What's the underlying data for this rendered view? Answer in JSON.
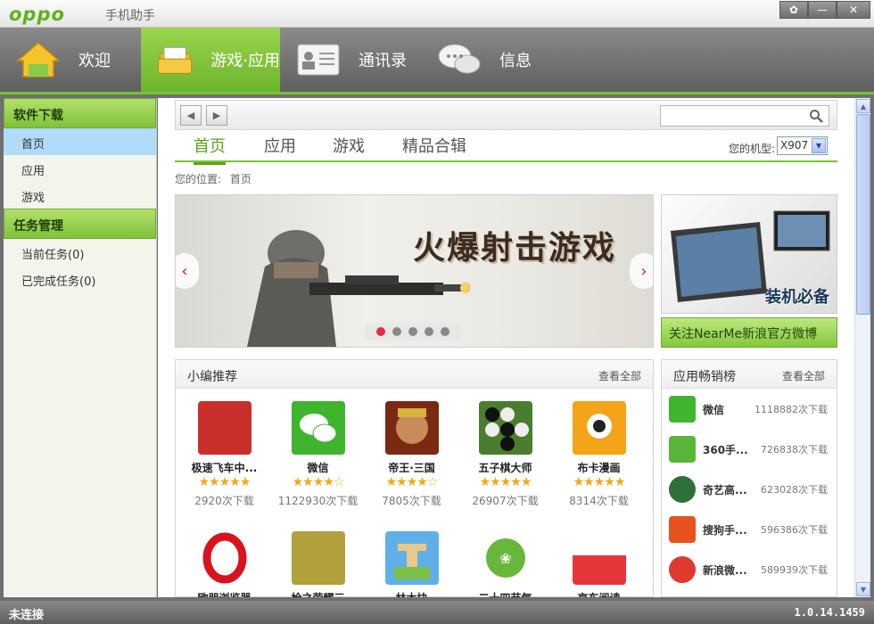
{
  "window": {
    "logo": "oppo",
    "title": "手机助手",
    "buttons": [
      "settings-icon",
      "minimize-icon",
      "close-icon"
    ]
  },
  "main_nav": [
    {
      "label": "欢迎",
      "icon": "home-icon",
      "active": false
    },
    {
      "label": "游戏·应用",
      "icon": "folder-icon",
      "active": true
    },
    {
      "label": "通讯录",
      "icon": "contacts-icon",
      "active": false
    },
    {
      "label": "信息",
      "icon": "chat-icon",
      "active": false
    }
  ],
  "sidebar": {
    "sections": [
      {
        "title": "软件下载",
        "items": [
          "首页",
          "应用",
          "游戏"
        ]
      },
      {
        "title": "任务管理",
        "items": [
          "当前任务(0)",
          "已完成任务(0)"
        ]
      }
    ]
  },
  "search": {
    "placeholder": "",
    "value": ""
  },
  "tabs": [
    "首页",
    "应用",
    "游戏",
    "精品合辑"
  ],
  "model": {
    "label": "您的机型:",
    "value": "X907"
  },
  "breadcrumb": {
    "label": "您的位置:",
    "current": "首页"
  },
  "banner": {
    "headline": "火爆射击游戏",
    "dots": 5,
    "active_dot": 0
  },
  "promo": {
    "text": "装机必备",
    "weibo_button": "关注NearMe新浪官方微博"
  },
  "recommended": {
    "title": "小编推荐",
    "more": "查看全部",
    "apps": [
      {
        "name": "极速飞车中...",
        "rating": 5,
        "downloads": "2920次下载",
        "color": "#c9302c"
      },
      {
        "name": "微信",
        "rating": 4.5,
        "downloads": "1122930次下载",
        "color": "#3fb42d"
      },
      {
        "name": "帝王·三国",
        "rating": 4.5,
        "downloads": "7805次下载",
        "color": "#7a2a12"
      },
      {
        "name": "五子棋大师",
        "rating": 5,
        "downloads": "26907次下载",
        "color": "#4a7d2e"
      },
      {
        "name": "布卡漫画",
        "rating": 5,
        "downloads": "8314次下载",
        "color": "#f5a318"
      },
      {
        "name": "欧朋浏览器",
        "rating": 0,
        "downloads": "",
        "color": "#d9121d"
      },
      {
        "name": "枪之荣耀三",
        "rating": 0,
        "downloads": "",
        "color": "#b2a03a"
      },
      {
        "name": "林木块",
        "rating": 0,
        "downloads": "",
        "color": "#5fb0e8"
      },
      {
        "name": "二十四节气",
        "rating": 0,
        "downloads": "",
        "color": "#67b83a"
      },
      {
        "name": "京东阅读",
        "rating": 0,
        "downloads": "",
        "color": "#e5373a"
      }
    ]
  },
  "top_sellers": {
    "title": "应用畅销榜",
    "more": "查看全部",
    "items": [
      {
        "name": "微信",
        "count": "1118882次下载",
        "color": "#3fb42d"
      },
      {
        "name": "360手...",
        "count": "726838次下载",
        "color": "#58b63a"
      },
      {
        "name": "奇艺高...",
        "count": "623028次下载",
        "color": "#2f6f3a"
      },
      {
        "name": "搜狗手...",
        "count": "596386次下载",
        "color": "#e8521f"
      },
      {
        "name": "新浪微...",
        "count": "589939次下载",
        "color": "#e0392f"
      }
    ]
  },
  "status": {
    "connection": "未连接",
    "version": "1.0.14.1459"
  },
  "colors": {
    "accent": "#7dc23a",
    "nav_bg": "#6f6f6f",
    "selected": "#b0dcfa"
  }
}
